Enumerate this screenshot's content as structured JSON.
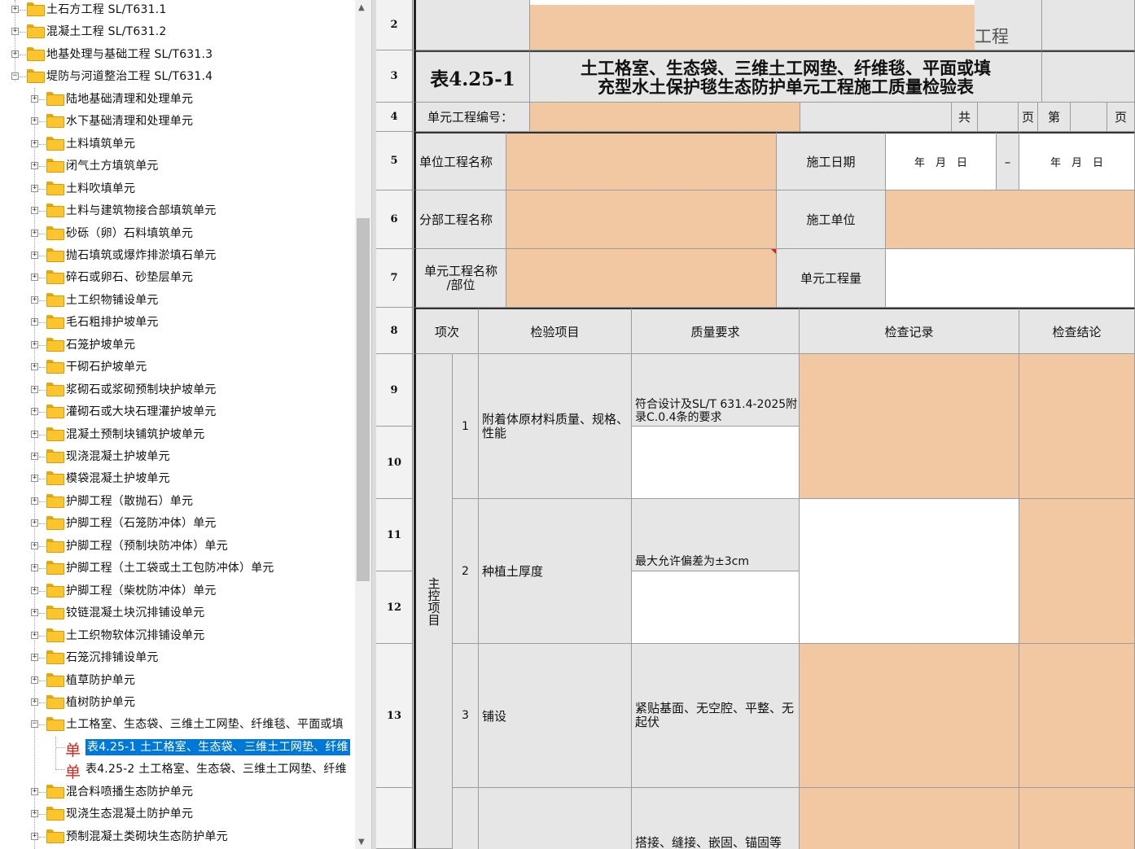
{
  "tree": {
    "items": [
      {
        "label": "土石方工程 SL/T631.1",
        "level": 0,
        "expanded": false
      },
      {
        "label": "混凝土工程 SL/T631.2",
        "level": 0,
        "expanded": false
      },
      {
        "label": "地基处理与基础工程 SL/T631.3",
        "level": 0,
        "expanded": false
      },
      {
        "label": "堤防与河道整治工程 SL/T631.4",
        "level": 0,
        "expanded": true
      },
      {
        "label": "陆地基础清理和处理单元",
        "level": 1,
        "expanded": false
      },
      {
        "label": "水下基础清理和处理单元",
        "level": 1,
        "expanded": false
      },
      {
        "label": "土料填筑单元",
        "level": 1,
        "expanded": false
      },
      {
        "label": "闭气土方填筑单元",
        "level": 1,
        "expanded": false
      },
      {
        "label": "土料吹填单元",
        "level": 1,
        "expanded": false
      },
      {
        "label": "土料与建筑物接合部填筑单元",
        "level": 1,
        "expanded": false
      },
      {
        "label": "砂砾（卵）石料填筑单元",
        "level": 1,
        "expanded": false
      },
      {
        "label": "抛石填筑或爆炸排淤填石单元",
        "level": 1,
        "expanded": false
      },
      {
        "label": "碎石或卵石、砂垫层单元",
        "level": 1,
        "expanded": false
      },
      {
        "label": "土工织物铺设单元",
        "level": 1,
        "expanded": false
      },
      {
        "label": "毛石粗排护坡单元",
        "level": 1,
        "expanded": false
      },
      {
        "label": "石笼护坡单元",
        "level": 1,
        "expanded": false
      },
      {
        "label": "干砌石护坡单元",
        "level": 1,
        "expanded": false
      },
      {
        "label": "浆砌石或浆砌预制块护坡单元",
        "level": 1,
        "expanded": false
      },
      {
        "label": "灌砌石或大块石理灌护坡单元",
        "level": 1,
        "expanded": false
      },
      {
        "label": "混凝土预制块铺筑护坡单元",
        "level": 1,
        "expanded": false
      },
      {
        "label": "现浇混凝土护坡单元",
        "level": 1,
        "expanded": false
      },
      {
        "label": "模袋混凝土护坡单元",
        "level": 1,
        "expanded": false
      },
      {
        "label": "护脚工程（散抛石）单元",
        "level": 1,
        "expanded": false
      },
      {
        "label": "护脚工程（石笼防冲体）单元",
        "level": 1,
        "expanded": false
      },
      {
        "label": "护脚工程（预制块防冲体）单元",
        "level": 1,
        "expanded": false
      },
      {
        "label": "护脚工程（土工袋或土工包防冲体）单元",
        "level": 1,
        "expanded": false
      },
      {
        "label": "护脚工程（柴枕防冲体）单元",
        "level": 1,
        "expanded": false
      },
      {
        "label": "铰链混凝土块沉排铺设单元",
        "level": 1,
        "expanded": false
      },
      {
        "label": "土工织物软体沉排铺设单元",
        "level": 1,
        "expanded": false
      },
      {
        "label": "石笼沉排铺设单元",
        "level": 1,
        "expanded": false
      },
      {
        "label": "植草防护单元",
        "level": 1,
        "expanded": false
      },
      {
        "label": "植树防护单元",
        "level": 1,
        "expanded": false
      },
      {
        "label": "土工格室、生态袋、三维土工网垫、纤维毯、平面或填",
        "level": 1,
        "expanded": true
      },
      {
        "label": "表4.25-1 土工格室、生态袋、三维土工网垫、纤维",
        "level": 2,
        "icon": "单",
        "selected": true
      },
      {
        "label": "表4.25-2 土工格室、生态袋、三维土工网垫、纤维",
        "level": 2,
        "icon": "单",
        "selected": false
      },
      {
        "label": "混合料喷播生态防护单元",
        "level": 1,
        "expanded": false
      },
      {
        "label": "现浇生态混凝土防护单元",
        "level": 1,
        "expanded": false
      },
      {
        "label": "预制混凝土类砌块生态防护单元",
        "level": 1,
        "expanded": false
      }
    ]
  },
  "sheet": {
    "row_numbers": {
      "r2": "2",
      "r3": "3",
      "r4": "4",
      "r5": "5",
      "r6": "6",
      "r7": "7",
      "r8": "8",
      "r9": "9",
      "r10": "10",
      "r11": "11",
      "r12": "12",
      "r13": "13"
    },
    "project_suffix": "工程",
    "table_no": "表4.25-1",
    "title_line1": "土工格室、生态袋、三维土工网垫、纤维毯、平面或填",
    "title_line2": "充型水土保护毯生态防护单元工程施工质量检验表",
    "unit_no_label": "单元工程编号：",
    "total_label": "共",
    "page_label": "页",
    "no_label": "第",
    "page_label2": "页",
    "unit_project_name": "单位工程名称",
    "construction_date": "施工日期",
    "date_from": "年　月　日",
    "date_dash": "–",
    "date_to": "年　月　日",
    "sub_project_name": "分部工程名称",
    "construction_unit": "施工单位",
    "unit_name_line1": "单元工程名称",
    "unit_name_line2": "/部位",
    "unit_quantity": "单元工程量",
    "headers": {
      "item_no": "项次",
      "inspect_item": "检验项目",
      "quality_req": "质量要求",
      "check_record": "检查记录",
      "conclusion": "检查结论"
    },
    "main_control": "主控项目",
    "items": [
      {
        "no": "1",
        "name": "附着体原材料质量、规格、性能",
        "req": "符合设计及SL/T 631.4-2025附录C.0.4条的要求"
      },
      {
        "no": "2",
        "name": "种植土厚度",
        "req": "最大允许偏差为±3cm"
      },
      {
        "no": "3",
        "name": "铺设",
        "req": "紧贴基面、无空腔、平整、无起伏"
      },
      {
        "no": "",
        "name": "",
        "req": "搭接、缝接、嵌固、锚固等"
      }
    ]
  },
  "colors": {
    "peach": "#f1c8a1",
    "selection": "#0078d7",
    "folder": "#fbc52b",
    "grey_cell": "#e6e6e6"
  }
}
